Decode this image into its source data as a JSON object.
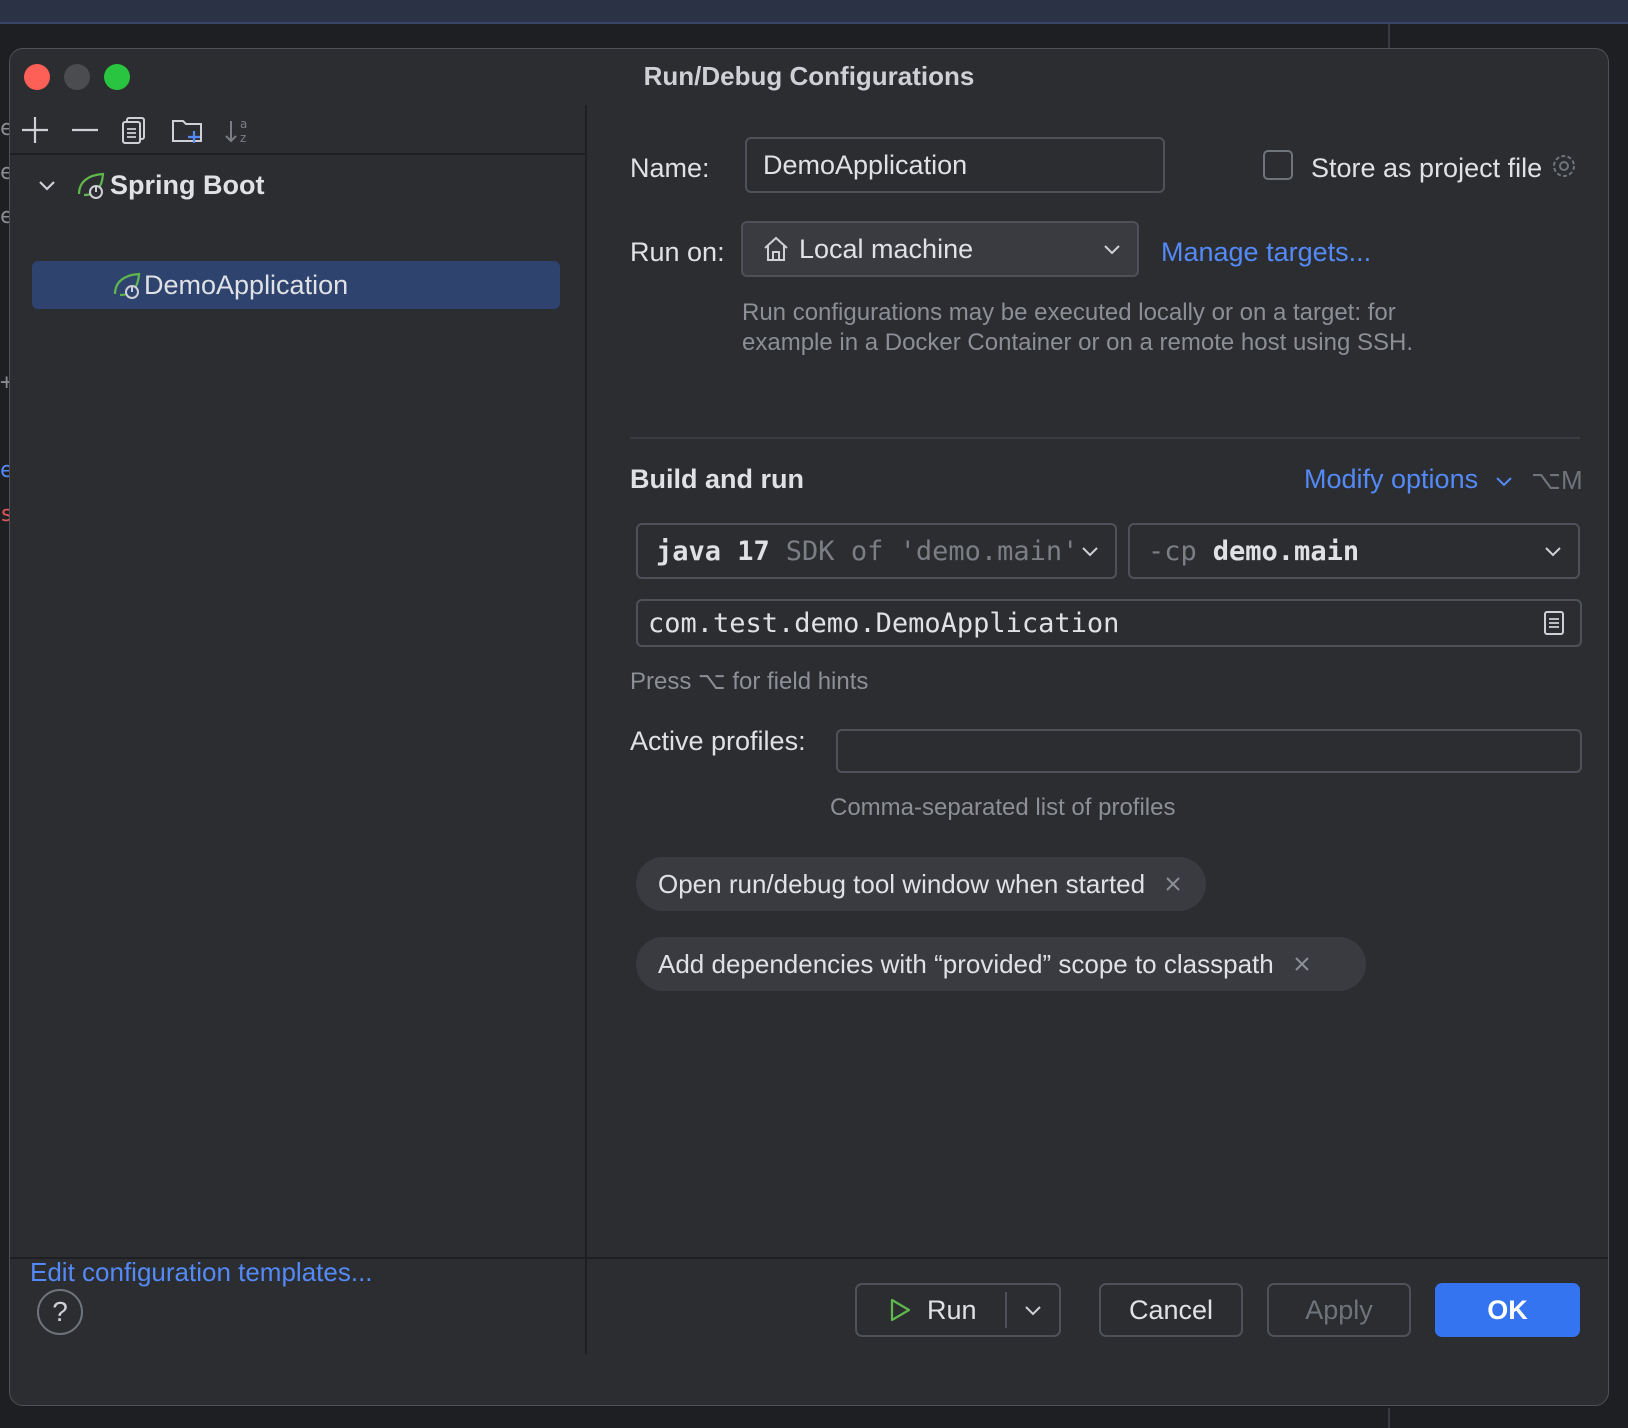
{
  "window": {
    "title": "Run/Debug Configurations"
  },
  "background": {
    "edge_glyphs": [
      "e",
      "e",
      "e",
      "+",
      "e",
      "s"
    ]
  },
  "toolbar": {
    "icons": [
      "add-icon",
      "remove-icon",
      "copy-icon",
      "new-folder-icon",
      "sort-alphabetically-icon"
    ]
  },
  "tree": {
    "group": {
      "label": "Spring Boot",
      "icon": "spring-boot-icon"
    },
    "items": [
      {
        "label": "DemoApplication",
        "icon": "spring-boot-icon",
        "selected": true
      }
    ]
  },
  "left_footer": {
    "edit_templates_link": "Edit configuration templates..."
  },
  "form": {
    "name_label": "Name:",
    "name_value": "DemoApplication",
    "store_as_project_file_label": "Store as project file",
    "store_as_project_file_checked": false,
    "run_on_label": "Run on:",
    "run_on_value": "Local machine",
    "manage_targets_link": "Manage targets...",
    "run_on_hint_line1": "Run configurations may be executed locally or on a target: for",
    "run_on_hint_line2": "example in a Docker Container or on a remote host using SSH.",
    "build_and_run_title": "Build and run",
    "modify_options_link": "Modify options",
    "modify_options_shortcut": "⌥M",
    "jdk_keyword": "java 17",
    "jdk_detail": "SDK of 'demo.main'",
    "cp_flag": "-cp",
    "cp_value": "demo.main",
    "main_class_value": "com.test.demo.DemoApplication",
    "field_hints_text": "Press ⌥ for field hints",
    "active_profiles_label": "Active profiles:",
    "active_profiles_value": "",
    "active_profiles_hint": "Comma-separated list of profiles",
    "chips": [
      "Open run/debug tool window when started",
      "Add dependencies with “provided” scope to classpath"
    ]
  },
  "footer": {
    "help_label": "?",
    "run_label": "Run",
    "cancel_label": "Cancel",
    "apply_label": "Apply",
    "ok_label": "OK"
  },
  "colors": {
    "accent": "#3574f0",
    "link": "#548af7",
    "selection": "#2e436e",
    "spring_green": "#5fb84b"
  }
}
